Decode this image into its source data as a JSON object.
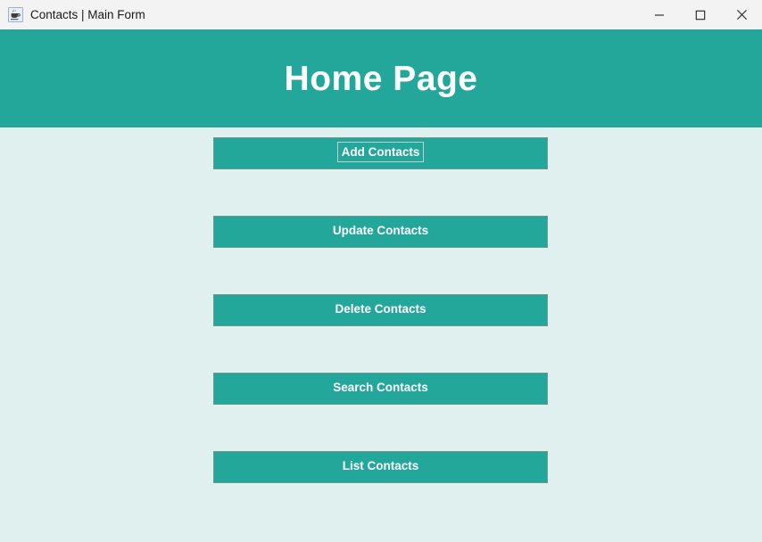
{
  "window": {
    "title": "Contacts | Main Form",
    "icon": "java-coffee-cup-icon",
    "controls": {
      "minimize": "minimize-icon",
      "maximize": "maximize-icon",
      "close": "close-icon"
    }
  },
  "header": {
    "title": "Home Page",
    "background_color": "#23a79b",
    "text_color": "#ffffff"
  },
  "body": {
    "background_color": "#dff0ef"
  },
  "menu": {
    "buttons": [
      {
        "label": "Add Contacts",
        "focused": true
      },
      {
        "label": "Update Contacts",
        "focused": false
      },
      {
        "label": "Delete Contacts",
        "focused": false
      },
      {
        "label": "Search Contacts",
        "focused": false
      },
      {
        "label": "List Contacts",
        "focused": false
      }
    ],
    "button_color": "#23a79b",
    "button_text_color": "#ffffff",
    "focus_ring_color": "#c3cdcc"
  }
}
